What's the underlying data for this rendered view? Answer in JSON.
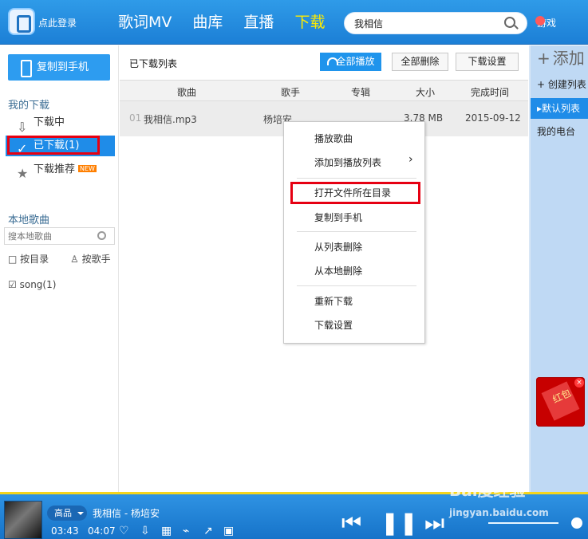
{
  "top": {
    "login": "点此登录",
    "nav": [
      "歌词MV",
      "曲库",
      "直播",
      "下载"
    ],
    "search_value": "我相信",
    "game": "游戏"
  },
  "left": {
    "phone_button": "复制到手机",
    "my_downloads": "我的下载",
    "downloading": "下载中",
    "downloaded": "已下载(1)",
    "recommend": "下载推荐",
    "new_badge": "NEW",
    "local_songs": "本地歌曲",
    "search_placeholder": "搜本地歌曲",
    "by_folder": "按目录",
    "by_singer": "按歌手",
    "song_folder": "song(1)"
  },
  "main": {
    "title": "已下载列表",
    "play_all": "全部播放",
    "delete_all": "全部删除",
    "settings": "下载设置",
    "headers": [
      "歌曲",
      "歌手",
      "专辑",
      "大小",
      "完成时间"
    ],
    "row": {
      "index": "01",
      "song": "我相信.mp3",
      "singer": "杨培安",
      "size": "3.78 MB",
      "date": "2015-09-12"
    }
  },
  "right": {
    "add": "添加",
    "create": "创建列表",
    "default": "默认列表",
    "radio": "我的电台",
    "hongbao": "红包"
  },
  "menu": {
    "items": [
      "播放歌曲",
      "添加到播放列表",
      "打开文件所在目录",
      "复制到手机",
      "从列表删除",
      "从本地删除",
      "重新下载",
      "下载设置"
    ]
  },
  "player": {
    "quality": "高品",
    "song": "我相信 - 杨培安",
    "current": "03:43",
    "total": "04:07"
  },
  "watermark": {
    "brand": "Bai度经验",
    "url": "jingyan.baidu.com"
  }
}
